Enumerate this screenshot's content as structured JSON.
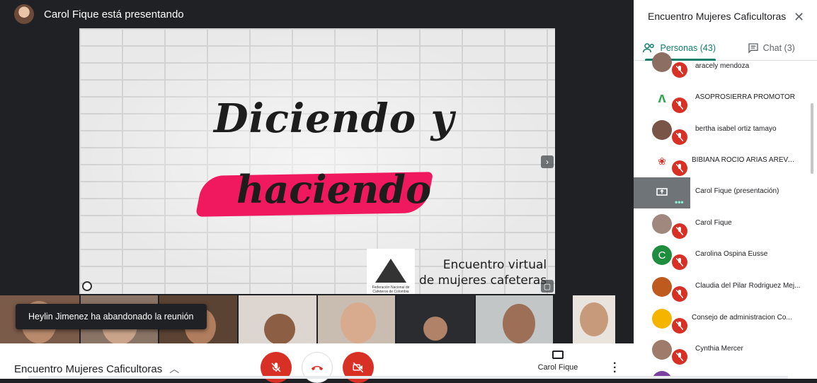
{
  "presenter": {
    "title": "Carol Fique está presentando"
  },
  "slide": {
    "line1": "Diciendo y",
    "line2": "haciendo",
    "footer_line1": "Encuentro virtual",
    "footer_line2": "de mujeres cafeteras",
    "logo_text": "Federación Nacional de Cafeteros de Colombia",
    "accent_color": "#f0195f"
  },
  "notification": {
    "text": "Heylin Jimenez ha abandonado la reunión"
  },
  "bottombar": {
    "meeting_name": "Encuentro Mujeres Caficultoras",
    "present_label": "Carol Fique"
  },
  "panel": {
    "title": "Encuentro Mujeres Caficultoras",
    "tabs": [
      {
        "label": "Personas (43)",
        "icon": "people-icon"
      },
      {
        "label": "Chat (3)",
        "icon": "chat-icon"
      }
    ],
    "people": [
      {
        "name": "aracely mendoza",
        "avatar_color": "#8d6e63",
        "initial": "",
        "muted": true
      },
      {
        "name": "ASOPROSIERRA PROMOTOR",
        "avatar_color": "#ffffff",
        "initial": "",
        "muted": true
      },
      {
        "name": "bertha isabel ortiz tamayo",
        "avatar_color": "#795548",
        "initial": "",
        "muted": true
      },
      {
        "name": "BIBIANA ROCIO ARIAS AREVA...",
        "avatar_color": "#ffffff",
        "initial": "",
        "muted": true
      },
      {
        "name": "Carol Fique (presentación)",
        "avatar_color": "#6f7478",
        "initial": "",
        "muted": false,
        "presenting": true
      },
      {
        "name": "Carol Fique",
        "avatar_color": "#a1887f",
        "initial": "",
        "muted": true
      },
      {
        "name": "Carolina Ospina Eusse",
        "avatar_color": "#1e8e3e",
        "initial": "C",
        "muted": true
      },
      {
        "name": "Claudia del Pilar Rodriguez Mej...",
        "avatar_color": "#bf5a1f",
        "initial": "",
        "muted": true
      },
      {
        "name": "Consejo de administracion Co...",
        "avatar_color": "#f4b400",
        "initial": "",
        "muted": true
      },
      {
        "name": "Cynthia Mercer",
        "avatar_color": "#9e7b6b",
        "initial": "",
        "muted": true
      }
    ]
  },
  "colors": {
    "danger": "#d93025",
    "accent": "#0f7e69",
    "stage": "#202124"
  }
}
